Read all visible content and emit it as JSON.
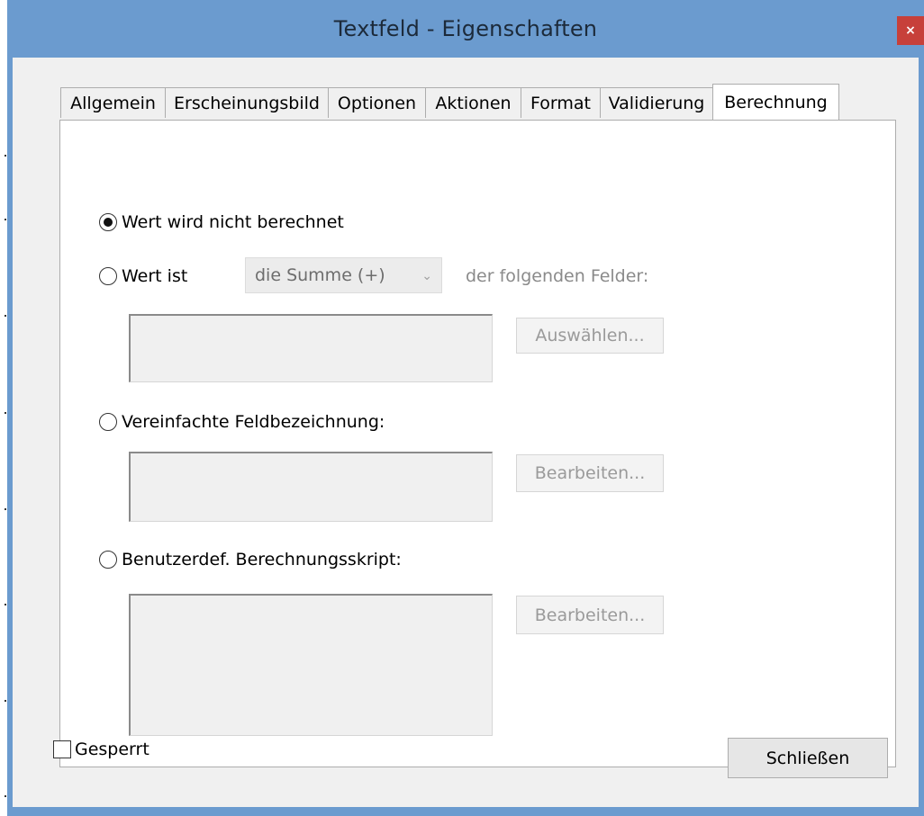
{
  "window": {
    "title": "Textfeld - Eigenschaften",
    "close_glyph": "×"
  },
  "tabs": [
    {
      "label": "Allgemein",
      "active": false
    },
    {
      "label": "Erscheinungsbild",
      "active": false
    },
    {
      "label": "Optionen",
      "active": false
    },
    {
      "label": "Aktionen",
      "active": false
    },
    {
      "label": "Format",
      "active": false
    },
    {
      "label": "Validierung",
      "active": false
    },
    {
      "label": "Berechnung",
      "active": true
    }
  ],
  "calc": {
    "opt_none_label": "Wert wird nicht berechnet",
    "opt_value_label": "Wert ist",
    "operation_selected": "die Summe (+)",
    "following_fields_label": "der folgenden Felder:",
    "select_button_label": "Auswählen...",
    "opt_simplified_label": "Vereinfachte Feldbezeichnung:",
    "edit_button_label": "Bearbeiten...",
    "opt_custom_script_label": "Benutzerdef. Berechnungsskript:",
    "edit_script_button_label": "Bearbeiten...",
    "selected_option": "none"
  },
  "footer": {
    "locked_label": "Gesperrt",
    "locked_checked": false,
    "close_button_label": "Schließen"
  },
  "colors": {
    "titlebar": "#6b9bcf",
    "close_button": "#c7403a",
    "dialog_background": "#f0f0f0",
    "panel_background": "#ffffff"
  }
}
